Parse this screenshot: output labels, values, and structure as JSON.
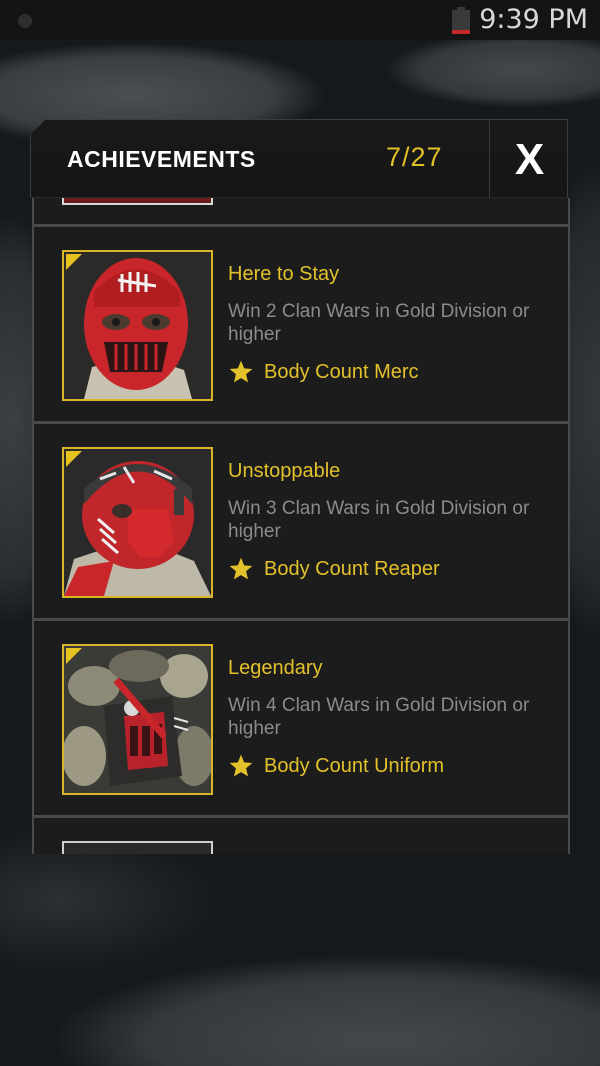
{
  "status_bar": {
    "time": "9:39 PM",
    "battery_icon": "battery-low-icon"
  },
  "dialog": {
    "title": "ACHIEVEMENTS",
    "progress": "7/27",
    "close_label": "X"
  },
  "achievements": [
    {
      "title": "",
      "description": "",
      "reward": ""
    },
    {
      "title": "Here to Stay",
      "description": "Win 2 Clan Wars in Gold Division or higher",
      "reward": "Body Count Merc",
      "reward_icon": "star-icon"
    },
    {
      "title": "Unstoppable",
      "description": "Win 3 Clan Wars in Gold Division or higher",
      "reward": "Body Count Reaper",
      "reward_icon": "star-icon"
    },
    {
      "title": "Legendary",
      "description": "Win 4 Clan Wars in Gold Division or higher",
      "reward": "Body Count Uniform",
      "reward_icon": "star-icon"
    },
    {
      "title": "",
      "description": "",
      "reward": ""
    }
  ],
  "colors": {
    "accent": "#e3c12a",
    "text_muted": "#8b8b8b",
    "card_bg": "#1c1c1c",
    "card_border": "#4a4a4a"
  }
}
